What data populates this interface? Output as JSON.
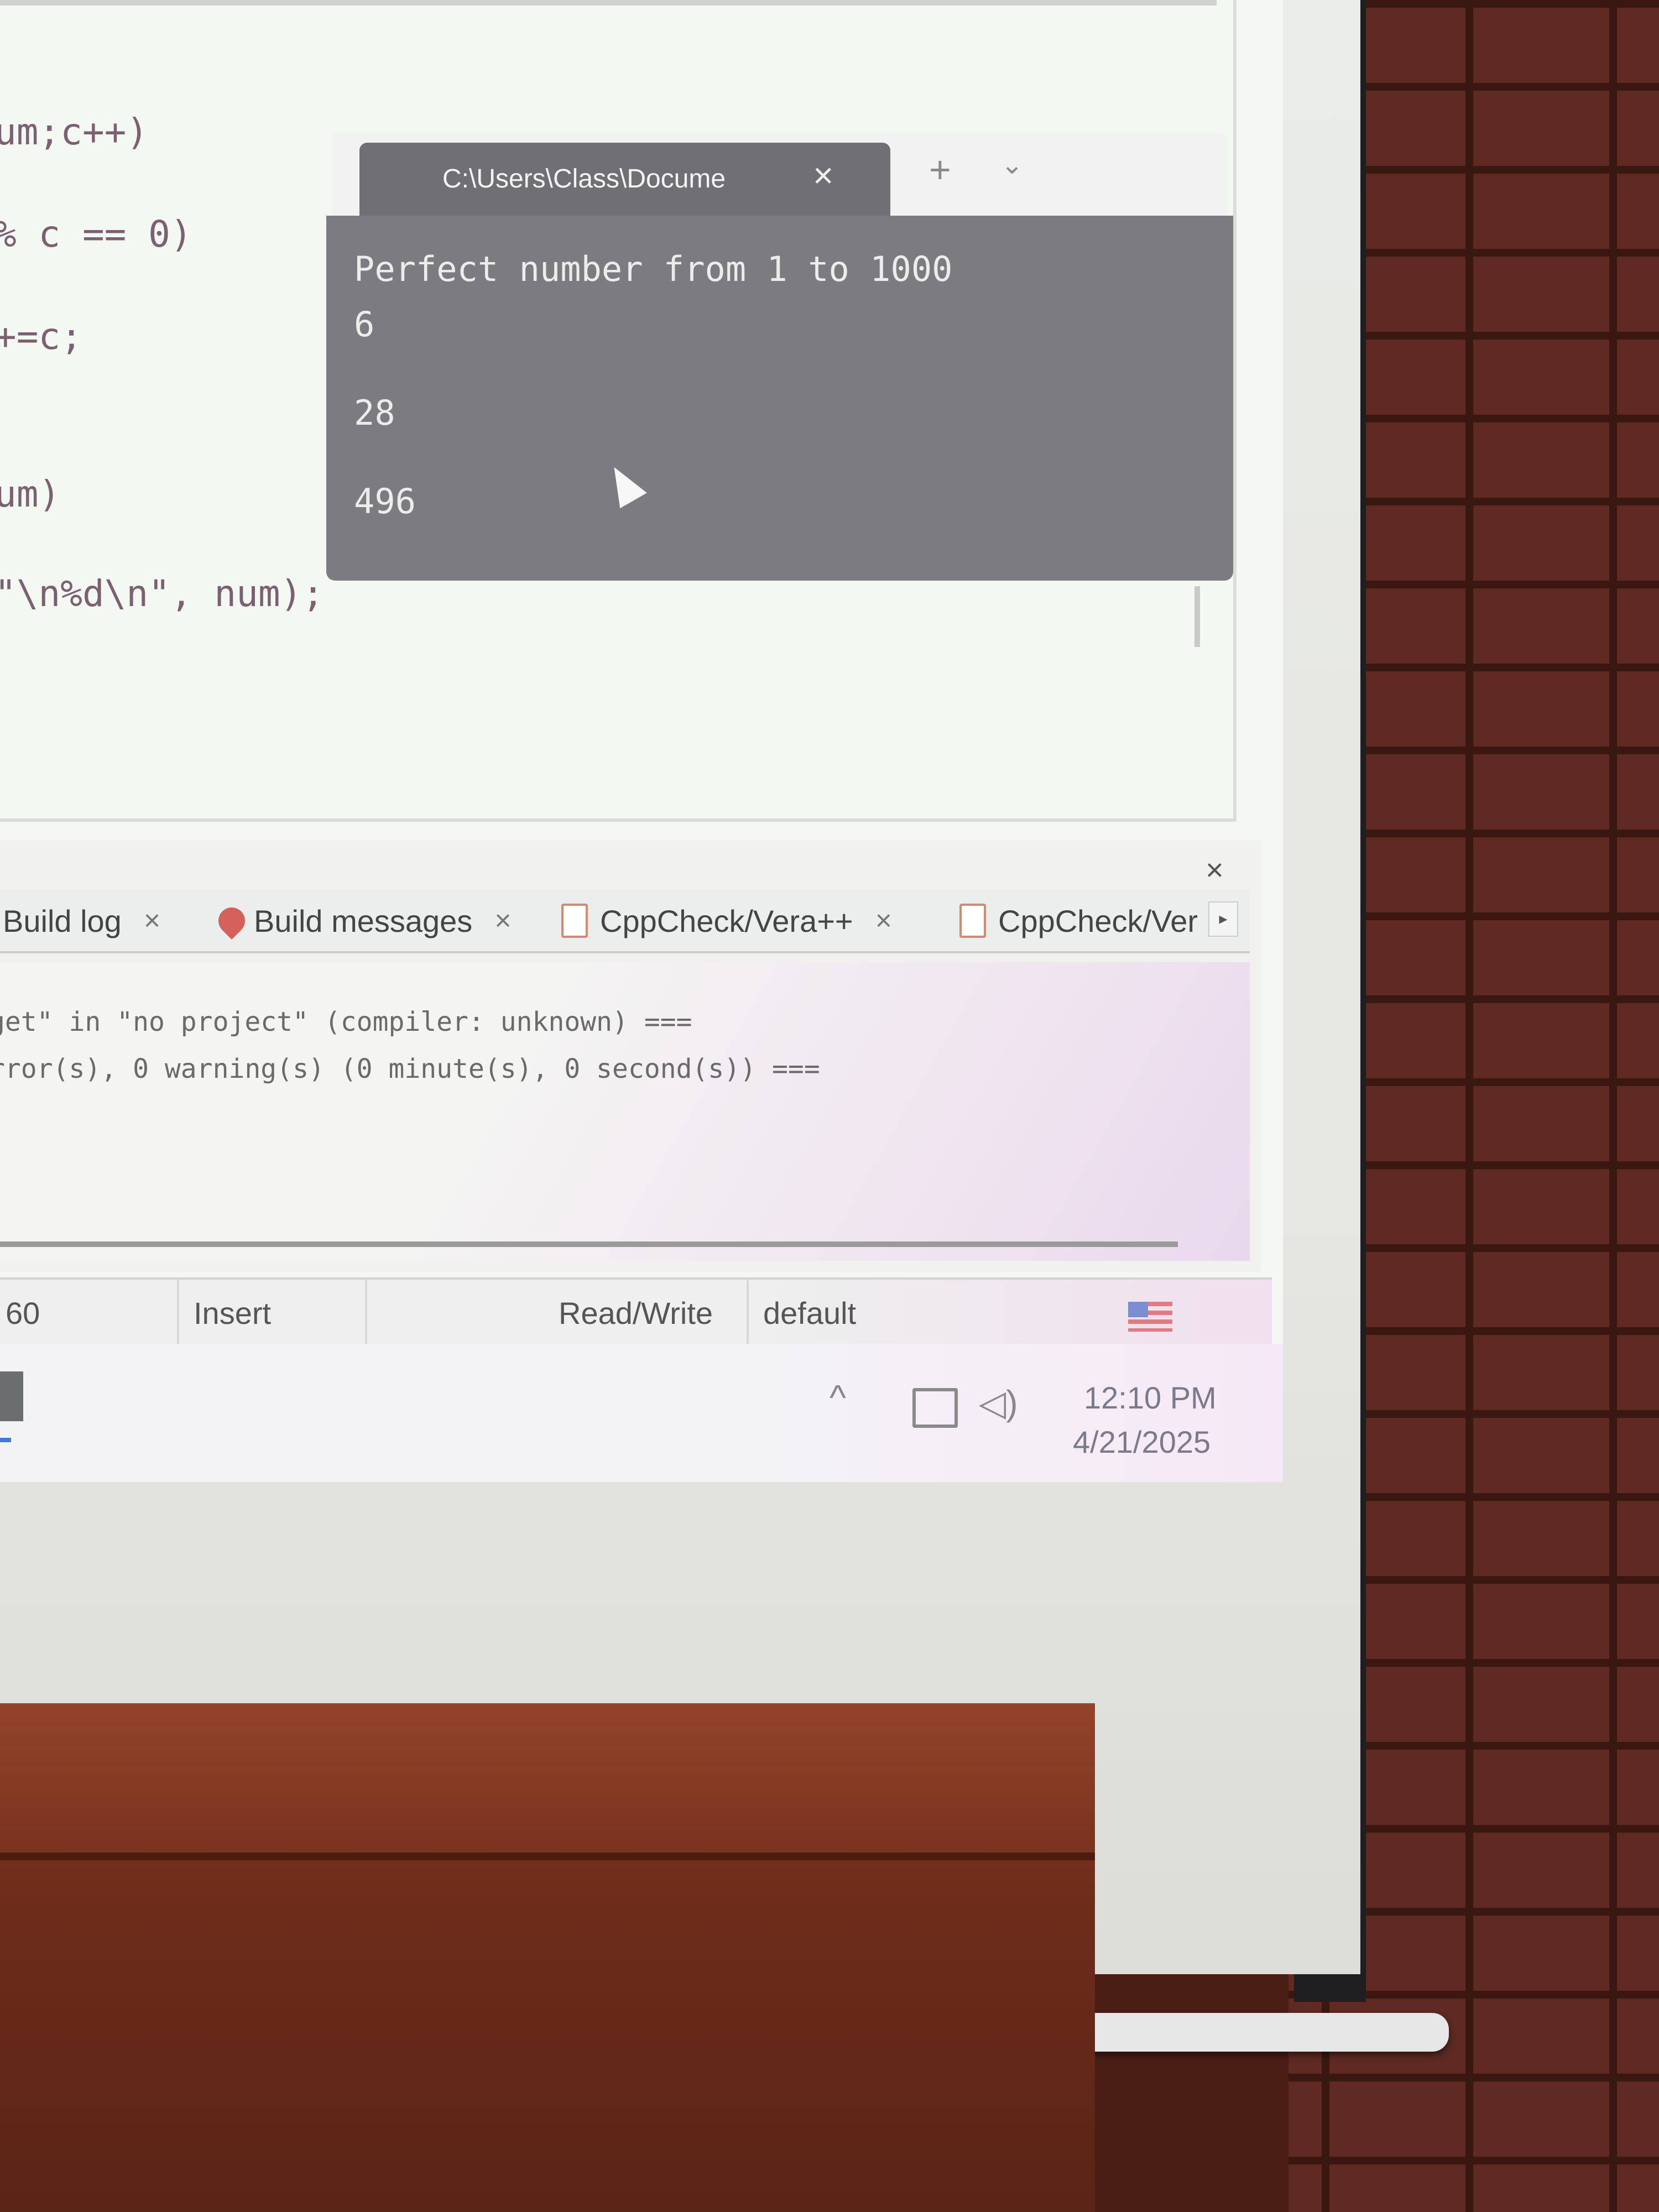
{
  "editor": {
    "code_lines": [
      "um;c++)",
      "% c == 0)",
      "+=c;",
      "um)",
      "\"\\n%d\\n\", num);"
    ]
  },
  "console": {
    "tab_title": "C:\\Users\\Class\\Docume",
    "close_icon": "×",
    "new_tab_icon": "+",
    "dropdown_icon": "⌄",
    "output": [
      "Perfect number from 1 to 1000",
      "6",
      "28",
      "496"
    ]
  },
  "logs": {
    "close_icon": "×",
    "tabs": [
      {
        "label": "Build log",
        "close": "×"
      },
      {
        "label": "Build messages",
        "close": "×"
      },
      {
        "label": "CppCheck/Vera++",
        "close": "×"
      },
      {
        "label": "CppCheck/Ver"
      }
    ],
    "scroll_arrow": "▸",
    "lines": [
      "get\" in \"no project\" (compiler: unknown) ===",
      "rror(s), 0 warning(s) (0 minute(s), 0 second(s)) ==="
    ]
  },
  "status": {
    "position": "60",
    "mode": "Insert",
    "access": "Read/Write",
    "profile": "default"
  },
  "taskbar": {
    "tray_chevron": "^",
    "volume_icon": "◁)",
    "time": "12:10 PM",
    "date": "4/21/2025"
  }
}
